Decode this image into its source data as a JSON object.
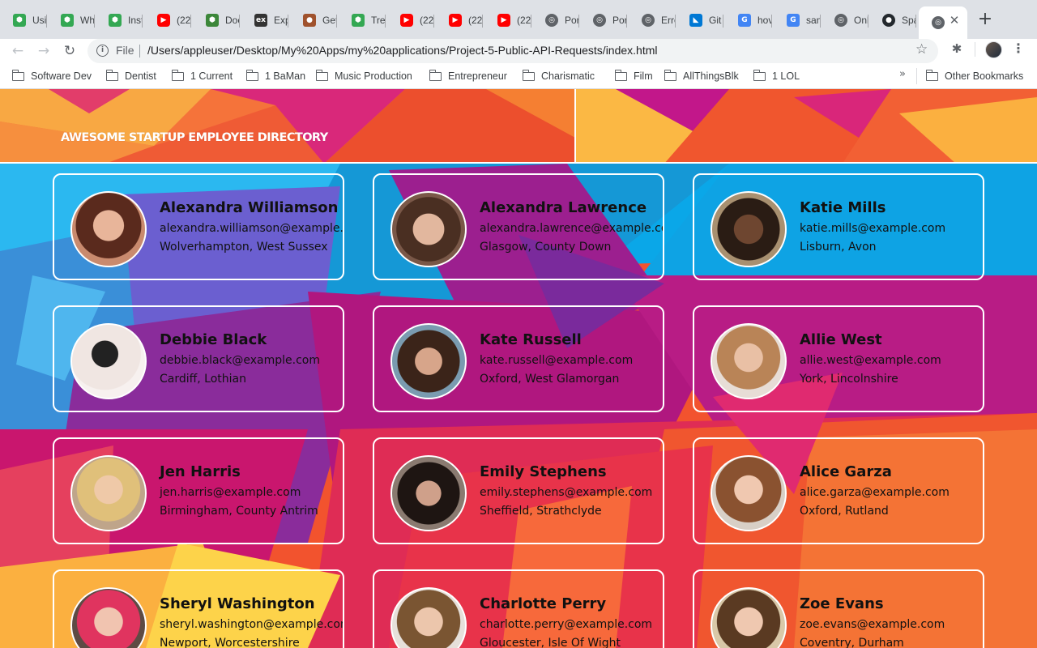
{
  "browser": {
    "tabs": [
      {
        "label": "Usi",
        "icon": "ext-icon"
      },
      {
        "label": "Wh",
        "icon": "ext-icon"
      },
      {
        "label": "Inst",
        "icon": "ext-icon"
      },
      {
        "label": "(22",
        "icon": "youtube-icon"
      },
      {
        "label": "Doc",
        "icon": "node-icon"
      },
      {
        "label": "Exp",
        "icon": "express-icon"
      },
      {
        "label": "Get",
        "icon": "pug-icon"
      },
      {
        "label": "Tre",
        "icon": "ext-icon"
      },
      {
        "label": "(22",
        "icon": "youtube-icon"
      },
      {
        "label": "(22",
        "icon": "youtube-icon"
      },
      {
        "label": "(22",
        "icon": "youtube-icon"
      },
      {
        "label": "Por",
        "icon": "globe-icon"
      },
      {
        "label": "Por",
        "icon": "globe-icon"
      },
      {
        "label": "Erro",
        "icon": "globe-icon"
      },
      {
        "label": "Git",
        "icon": "vscode-icon"
      },
      {
        "label": "hov",
        "icon": "google-icon"
      },
      {
        "label": "san",
        "icon": "google-icon"
      },
      {
        "label": "Onl",
        "icon": "globe-icon"
      },
      {
        "label": "Spa",
        "icon": "github-icon"
      }
    ],
    "active_tab_icon": "globe-icon",
    "address": {
      "scheme": "File",
      "url": "/Users/appleuser/Desktop/My%20Apps/my%20applications/Project-5-Public-API-Requests/index.html"
    },
    "bookmarks": [
      "Software Dev",
      "Dentist",
      "1 Current",
      "1 BaMan",
      "Music Production",
      "Entrepreneur",
      "Charismatic",
      "Film",
      "AllThingsBlk",
      "1 LOL"
    ],
    "bookmarks_more": "»",
    "other_bookmarks": "Other Bookmarks"
  },
  "page": {
    "title": "AWESOME STARTUP EMPLOYEE DIRECTORY",
    "employees": [
      {
        "name": "Alexandra Williamson",
        "email": "alexandra.williamson@example.com",
        "location": "Wolverhampton, West Sussex"
      },
      {
        "name": "Alexandra Lawrence",
        "email": "alexandra.lawrence@example.com",
        "location": "Glasgow, County Down"
      },
      {
        "name": "Katie Mills",
        "email": "katie.mills@example.com",
        "location": "Lisburn, Avon"
      },
      {
        "name": "Debbie Black",
        "email": "debbie.black@example.com",
        "location": "Cardiff, Lothian"
      },
      {
        "name": "Kate Russell",
        "email": "kate.russell@example.com",
        "location": "Oxford, West Glamorgan"
      },
      {
        "name": "Allie West",
        "email": "allie.west@example.com",
        "location": "York, Lincolnshire"
      },
      {
        "name": "Jen Harris",
        "email": "jen.harris@example.com",
        "location": "Birmingham, County Antrim"
      },
      {
        "name": "Emily Stephens",
        "email": "emily.stephens@example.com",
        "location": "Sheffield, Strathclyde"
      },
      {
        "name": "Alice Garza",
        "email": "alice.garza@example.com",
        "location": "Oxford, Rutland"
      },
      {
        "name": "Sheryl Washington",
        "email": "sheryl.washington@example.com",
        "location": "Newport, Worcestershire"
      },
      {
        "name": "Charlotte Perry",
        "email": "charlotte.perry@example.com",
        "location": "Gloucester, Isle Of Wight"
      },
      {
        "name": "Zoe Evans",
        "email": "zoe.evans@example.com",
        "location": "Coventry, Durham"
      }
    ]
  }
}
